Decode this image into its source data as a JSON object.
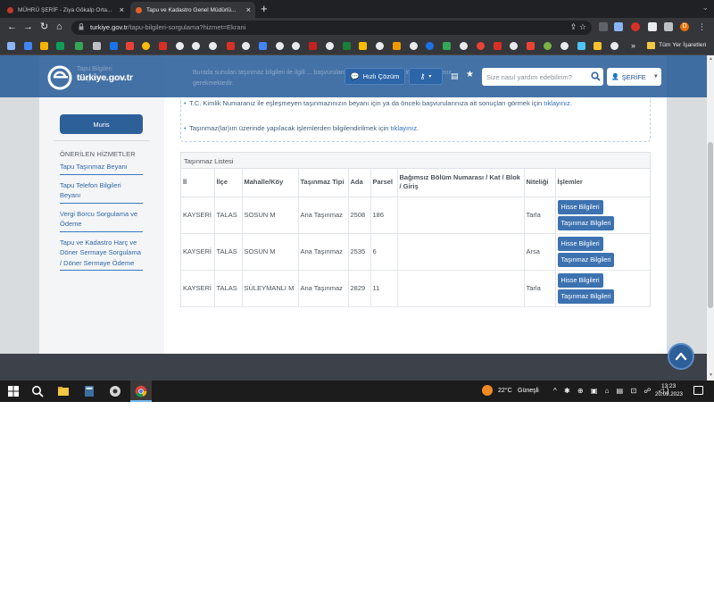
{
  "browser": {
    "tabs": [
      {
        "title": "MÜHRÜ ŞERİF - Ziya Gökalp Orta...",
        "active": false
      },
      {
        "title": "Tapu ve Kadastro Genel Müdürlü...",
        "active": true
      }
    ],
    "url": {
      "host": "turkiye.gov.tr",
      "path": "/tapu-bilgileri-sorgulama?hizmet=Ekrani"
    },
    "bookmarks_all_label": "Tüm Yer İşaretleri",
    "profile_initial": "D"
  },
  "header": {
    "logo_text": "türkiye.gov.tr",
    "faded_text": [
      "Tapu Bilgileri",
      "Sorgulama Ekranı"
    ],
    "hizli_cozum": "Hızlı Çözüm",
    "search_placeholder": "Size nasıl yardım edebilirim?",
    "user_name": "ŞERİFE"
  },
  "info": {
    "faded_line": "Burada sunulan taşınmaz bilgileri ile ilgili ... başvurulardan ilgili eşleşme birimine başvurmanız gerekmektedir.",
    "items": [
      {
        "text": "T.C. Kimlik Numaranız ile eşleşmeyen taşınmazınızın beyanı için ya da önceki başvurularınıza ait sonuçları görmek için",
        "link": "tıklayınız."
      },
      {
        "text": "Taşınmaz(lar)ım üzerinde yapılacak işlemlerden bilgilendirilmek için",
        "link": "tıklayınız."
      }
    ]
  },
  "sidebar": {
    "muris_label": "Muris",
    "section_title": "ÖNERİLEN HİZMETLER",
    "links": [
      "Tapu Taşınmaz Beyanı",
      "Tapu Telefon Bilgileri Beyanı",
      "Vergi Borcu Sorgulama ve Ödeme",
      "Tapu ve Kadastro Harç ve Döner Sermaye Sorgulama / Döner Sermaye Ödeme"
    ]
  },
  "table": {
    "title": "Taşınmaz Listesi",
    "headers": [
      "İl",
      "İlçe",
      "Mahalle/Köy",
      "Taşınmaz Tipi",
      "Ada",
      "Parsel",
      "Bağımsız Bölüm Numarası / Kat / Blok / Giriş",
      "Niteliği",
      "İşlemler"
    ],
    "rows": [
      {
        "il": "KAYSERİ",
        "ilce": "TALAS",
        "mahalle": "SOSUN M",
        "tip": "Ana Taşınmaz",
        "ada": "2508",
        "parsel": "186",
        "bolum": "",
        "nitelik": "Tarla"
      },
      {
        "il": "KAYSERİ",
        "ilce": "TALAS",
        "mahalle": "SOSUN M",
        "tip": "Ana Taşınmaz",
        "ada": "2535",
        "parsel": "6",
        "bolum": "",
        "nitelik": "Arsa"
      },
      {
        "il": "KAYSERİ",
        "ilce": "TALAS",
        "mahalle": "SÜLEYMANLI M",
        "tip": "Ana Taşınmaz",
        "ada": "2829",
        "parsel": "11",
        "bolum": "",
        "nitelik": "Tarla"
      }
    ],
    "action_labels": {
      "hisse": "Hisse Bilgileri",
      "tasinmaz": "Taşınmaz Bilgileri"
    }
  },
  "taskbar": {
    "weather_temp": "22°C",
    "weather_desc": "Güneşli",
    "time": "13:23",
    "date": "20.09.2023"
  },
  "colors": {
    "header_blue": "#2d5f99",
    "link_blue": "#2f67a5",
    "button_blue": "#3d72b0",
    "chrome_dark": "#202124"
  }
}
